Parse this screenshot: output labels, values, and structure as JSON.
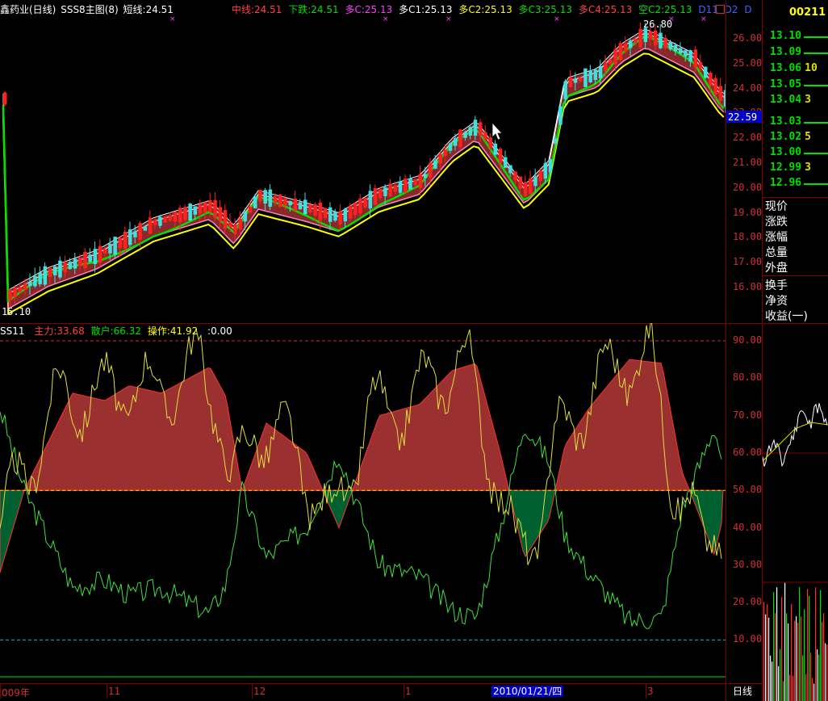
{
  "header": {
    "title": "鑫药业(日线)",
    "formula": "SSS8主图(8)",
    "short_line": "短线:24.51",
    "mid_line": "中线:24.51",
    "down": "下跌:24.51",
    "duo_c": "多C:25.13",
    "duo_c1": "多C1:25.13",
    "duo_c2": "多C2:25.13",
    "duo_c3": "多C3:25.13",
    "duo_c4": "多C4:25.13",
    "kong_c2": "空C2:25.13",
    "d11": "D11",
    "d2": "D2",
    "d": "D",
    "stock_code": "00211"
  },
  "main_chart": {
    "price_axis": [
      "26.00",
      "25.00",
      "24.00",
      "23.00",
      "22.00",
      "21.00",
      "20.00",
      "19.00",
      "18.00",
      "17.00",
      "16.00"
    ],
    "current_price": "22.59",
    "high_label": "26.80",
    "low_label": "15.10",
    "colors": {
      "up": "#ff2020",
      "down": "#40e0e0",
      "yellow": "#ffff00",
      "green": "#00e000",
      "band": "#a03030"
    }
  },
  "indicator": {
    "name": "SS11",
    "main_force": "主力:33.68",
    "retail": "散户:66.32",
    "operation": "操作:41.92",
    "extra": ":0.00",
    "axis": [
      "90.00",
      "80.00",
      "70.00",
      "60.00",
      "50.00",
      "40.00",
      "30.00",
      "20.00",
      "10.00"
    ]
  },
  "dates": {
    "items": [
      "009年",
      "11",
      "12",
      "1",
      "3"
    ],
    "cursor_date": "2010/01/21/四",
    "period": "日线"
  },
  "order_book": [
    {
      "price": "13.10",
      "vol": ""
    },
    {
      "price": "13.09",
      "vol": ""
    },
    {
      "price": "13.06",
      "vol": "10"
    },
    {
      "price": "13.05",
      "vol": ""
    },
    {
      "price": "13.04",
      "vol": "3"
    },
    {
      "price": "13.03",
      "vol": ""
    },
    {
      "price": "13.02",
      "vol": "5"
    },
    {
      "price": "13.00",
      "vol": ""
    },
    {
      "price": "12.99",
      "vol": "3"
    },
    {
      "price": "12.96",
      "vol": ""
    }
  ],
  "info_labels": [
    "现价",
    "涨跌",
    "涨幅",
    "总量",
    "外盘",
    "换手",
    "净资",
    "收益(一)"
  ]
}
